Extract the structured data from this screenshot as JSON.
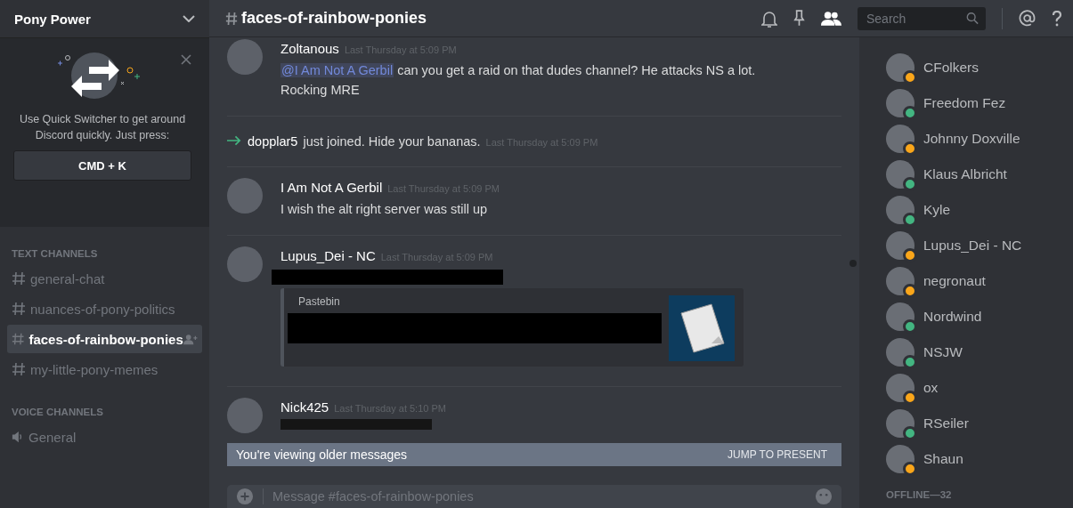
{
  "server": {
    "name": "Pony Power"
  },
  "quick_switcher": {
    "text": "Use Quick Switcher to get around Discord quickly. Just press:",
    "shortcut": "CMD + K"
  },
  "channel_groups": [
    {
      "title": "TEXT CHANNELS",
      "kind": "text",
      "channels": [
        {
          "name": "general-chat",
          "selected": false
        },
        {
          "name": "nuances-of-pony-politics",
          "selected": false
        },
        {
          "name": "faces-of-rainbow-ponies",
          "selected": true
        },
        {
          "name": "my-little-pony-memes",
          "selected": false
        }
      ]
    },
    {
      "title": "VOICE CHANNELS",
      "kind": "voice",
      "channels": [
        {
          "name": "General",
          "selected": false
        }
      ]
    }
  ],
  "header": {
    "channel": "faces-of-rainbow-ponies",
    "search_placeholder": "Search"
  },
  "messages": [
    {
      "kind": "message",
      "author": "Zoltanous",
      "time": "Last Thursday at 5:09 PM",
      "parts": [
        {
          "kind": "text",
          "mention": "@I Am Not A Gerbil",
          "text": " can you get a raid on that dudes channel? He attacks NS a lot."
        },
        {
          "kind": "text",
          "text": "Rocking MRE"
        }
      ]
    },
    {
      "kind": "join",
      "author": "dopplar5",
      "text": " just joined. Hide your bananas.",
      "time": "Last Thursday at 5:09 PM"
    },
    {
      "kind": "message",
      "author": "I Am Not A Gerbil",
      "time": "Last Thursday at 5:09 PM",
      "parts": [
        {
          "kind": "text",
          "text": "I wish the alt right server was still up"
        }
      ]
    },
    {
      "kind": "message",
      "author": "Lupus_Dei - NC",
      "time": "Last Thursday at 5:09 PM",
      "parts": [
        {
          "kind": "redacted"
        },
        {
          "kind": "embed",
          "provider": "Pastebin"
        }
      ]
    },
    {
      "kind": "message",
      "author": "Nick425",
      "time": "Last Thursday at 5:10 PM",
      "parts": [
        {
          "kind": "image"
        }
      ]
    }
  ],
  "banner": {
    "text": "You're viewing older messages",
    "action": "JUMP TO PRESENT"
  },
  "composer": {
    "placeholder": "Message #faces-of-rainbow-ponies"
  },
  "members": [
    {
      "name": "CFolkers",
      "color": "#faa61a"
    },
    {
      "name": "Freedom Fez",
      "color": "#43b581"
    },
    {
      "name": "Johnny Doxville",
      "color": "#faa61a"
    },
    {
      "name": "Klaus Albricht",
      "color": "#43b581"
    },
    {
      "name": "Kyle",
      "color": "#43b581"
    },
    {
      "name": "Lupus_Dei - NC",
      "color": "#faa61a"
    },
    {
      "name": "negronaut",
      "color": "#faa61a"
    },
    {
      "name": "Nordwind",
      "color": "#43b581"
    },
    {
      "name": "NSJW",
      "color": "#43b581"
    },
    {
      "name": "ox",
      "color": "#faa61a"
    },
    {
      "name": "RSeiler",
      "color": "#43b581"
    },
    {
      "name": "Shaun",
      "color": "#faa61a"
    }
  ],
  "offline_header": "OFFLINE—32"
}
